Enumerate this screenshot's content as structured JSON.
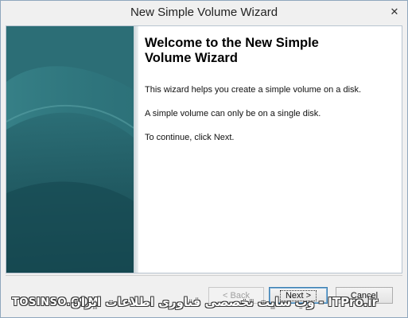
{
  "window": {
    "title": "New Simple Volume Wizard",
    "close_glyph": "✕"
  },
  "welcome": {
    "heading_line1": "Welcome to the New Simple",
    "heading_line2": "Volume Wizard",
    "paragraph1": "This wizard helps you create a simple volume on a disk.",
    "paragraph2": "A simple volume can only be on a single disk.",
    "paragraph3": "To continue, click Next."
  },
  "buttons": {
    "back_label": "< Back",
    "next_label": "Next >",
    "cancel_label": "Cancel"
  },
  "watermark": {
    "left": "TOSINSO.COM",
    "right": "ITPro.ir - وب سایت تخصصی فناوری اطلاعات ایران"
  },
  "icons": {
    "close": "close-icon"
  },
  "colors": {
    "banner": "#2a7078",
    "window_bg": "#f0f0f0",
    "next_border": "#3c7fb1"
  }
}
